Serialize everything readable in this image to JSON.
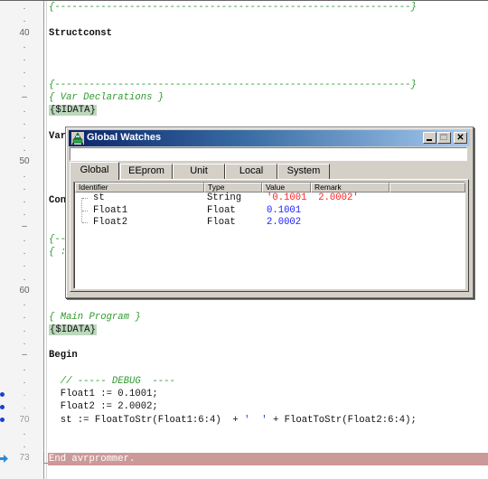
{
  "editor": {
    "gutter": [
      {
        "line": 38,
        "mark": "."
      },
      {
        "line": 39,
        "mark": "."
      },
      {
        "line": 40,
        "mark": "40"
      },
      {
        "line": 41,
        "mark": "."
      },
      {
        "line": 42,
        "mark": "."
      },
      {
        "line": 43,
        "mark": "."
      },
      {
        "line": 44,
        "mark": "."
      },
      {
        "line": 45,
        "mark": "–"
      },
      {
        "line": 46,
        "mark": "."
      },
      {
        "line": 47,
        "mark": "."
      },
      {
        "line": 48,
        "mark": "."
      },
      {
        "line": 49,
        "mark": "."
      },
      {
        "line": 50,
        "mark": "50"
      },
      {
        "line": 51,
        "mark": "."
      },
      {
        "line": 52,
        "mark": "."
      },
      {
        "line": 53,
        "mark": "."
      },
      {
        "line": 54,
        "mark": "."
      },
      {
        "line": 55,
        "mark": "–"
      },
      {
        "line": 56,
        "mark": "."
      },
      {
        "line": 57,
        "mark": "."
      },
      {
        "line": 58,
        "mark": "."
      },
      {
        "line": 59,
        "mark": "."
      },
      {
        "line": 60,
        "mark": "60"
      },
      {
        "line": 61,
        "mark": "."
      },
      {
        "line": 62,
        "mark": "."
      },
      {
        "line": 63,
        "mark": "."
      },
      {
        "line": 64,
        "mark": "."
      },
      {
        "line": 65,
        "mark": "–"
      },
      {
        "line": 66,
        "mark": "."
      },
      {
        "line": 67,
        "mark": "."
      },
      {
        "line": 68,
        "mark": ".",
        "breakpoint": true,
        "faint": true
      },
      {
        "line": 69,
        "mark": ".",
        "breakpoint": true,
        "faint": true
      },
      {
        "line": 70,
        "mark": "70",
        "breakpoint": true,
        "faint": true
      },
      {
        "line": 71,
        "mark": "."
      },
      {
        "line": 72,
        "mark": "."
      },
      {
        "line": 73,
        "mark": "73",
        "current": true,
        "faint": true
      }
    ],
    "lines": {
      "l38": "{--------------------------------------------------------------}",
      "l40": "Structconst",
      "l44": "{--------------------------------------------------------------}",
      "l45": "{ Var Declarations }",
      "l46": "{$IDATA}",
      "l48": "Var",
      "l53": "Con",
      "l56": "{--",
      "l57": "{ :",
      "l62": "{ Main Program }",
      "l63": "{$IDATA}",
      "l65": "Begin",
      "l67": "  // ----- DEBUG  ----",
      "l68": "  Float1 := 0.1001;",
      "l69": "  Float2 := 2.0002;",
      "l70_a": "  st := FloatToStr(Float1:6:4)  + ",
      "l70_str": "'  '",
      "l70_b": " + FloatToStr(Float2:6:4);",
      "l73": "End avrprommer."
    },
    "colors": {
      "comment": "#2e9a2e",
      "directive_bg": "#bcd8bc",
      "current_line_bg": "#cc9999",
      "breakpoint": "#1a3fd6"
    }
  },
  "watch_window": {
    "title": "Global Watches",
    "expression_input": "",
    "buttons": {
      "minimize": "_",
      "maximize": "□",
      "close": "✕"
    },
    "tabs": [
      {
        "label": "Global",
        "active": true
      },
      {
        "label": "EEprom",
        "active": false
      },
      {
        "label": "Unit",
        "active": false
      },
      {
        "label": "Local",
        "active": false
      },
      {
        "label": "System",
        "active": false
      }
    ],
    "columns": [
      "Identifier",
      "Type",
      "Value",
      "Remark"
    ],
    "rows": [
      {
        "identifier": "st",
        "type": "String",
        "value": "'0.1001  2.0002'",
        "value_color": "red",
        "remark": ""
      },
      {
        "identifier": "Float1",
        "type": "Float",
        "value": "0.1001",
        "value_color": "blue",
        "remark": ""
      },
      {
        "identifier": "Float2",
        "type": "Float",
        "value": "2.0002",
        "value_color": "blue",
        "remark": ""
      }
    ]
  }
}
